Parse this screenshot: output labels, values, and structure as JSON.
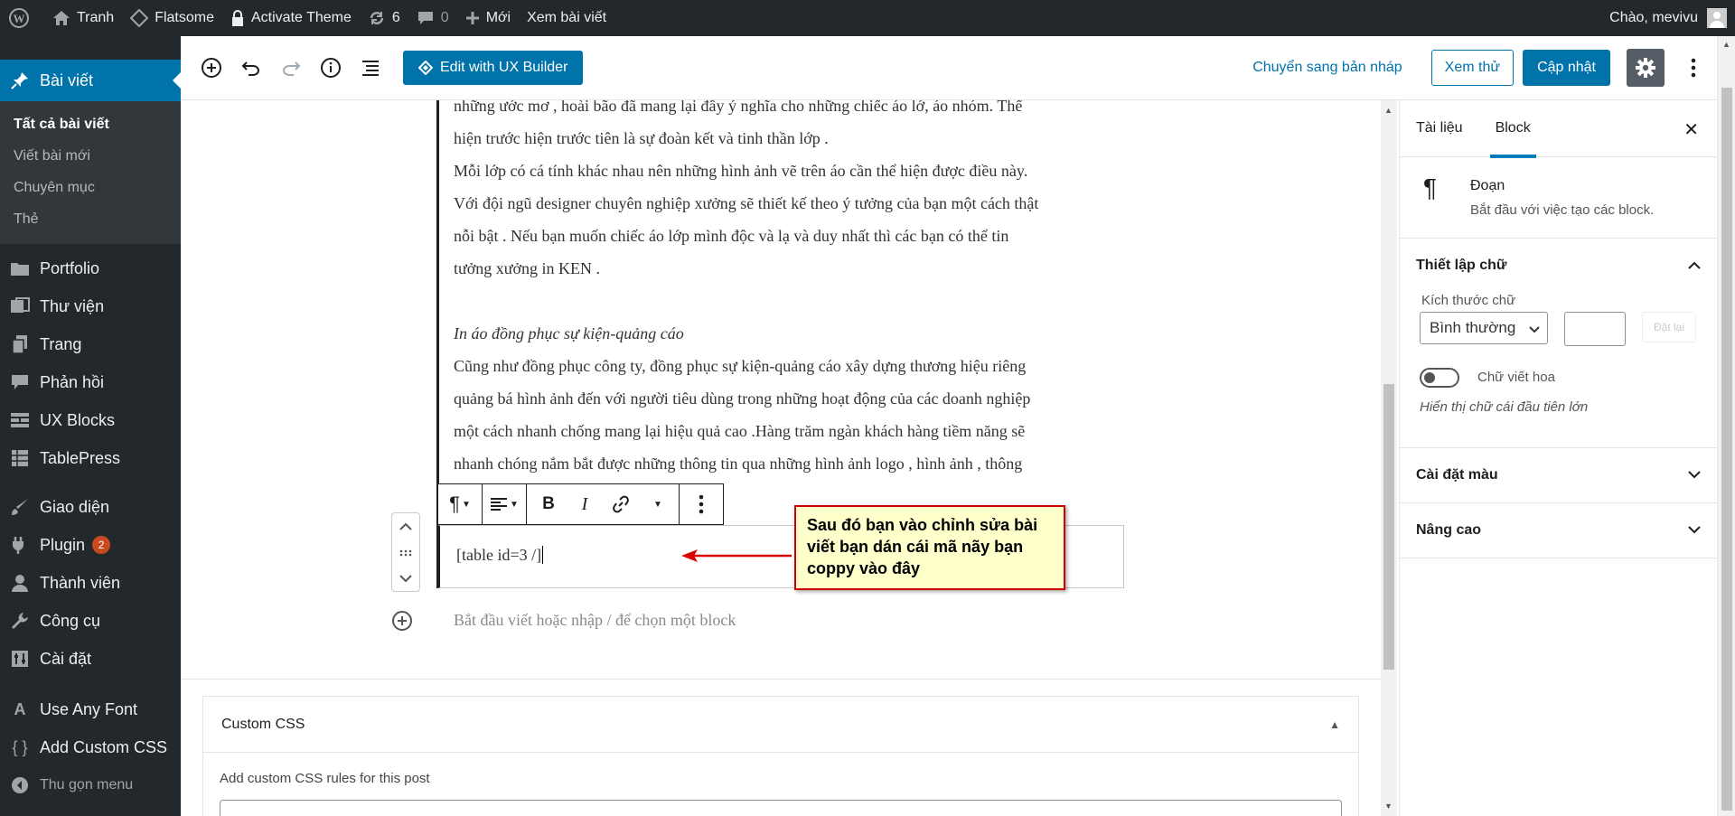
{
  "adminbar": {
    "site_name": "Tranh",
    "theme": "Flatsome",
    "activate": "Activate Theme",
    "updates_count": "6",
    "comments_count": "0",
    "new": "Mới",
    "view_post": "Xem bài viết",
    "greeting": "Chào, mevivu"
  },
  "menu": {
    "posts": "Bài viết",
    "sub": [
      "Tất cả bài viết",
      "Viết bài mới",
      "Chuyên mục",
      "Thẻ"
    ],
    "items": [
      "Portfolio",
      "Thư viện",
      "Trang",
      "Phản hồi",
      "UX Blocks",
      "TablePress",
      "Giao diện",
      "Plugin",
      "Thành viên",
      "Công cụ",
      "Cài đặt",
      "Use Any Font",
      "Add Custom CSS"
    ],
    "plugin_badge": "2",
    "collapse": "Thu gọn menu"
  },
  "header": {
    "ux_builder": "Edit with UX Builder",
    "switch_draft": "Chuyển sang bản nháp",
    "preview": "Xem thử",
    "update": "Cập nhật"
  },
  "content": {
    "lines_top": [
      "những ước mơ , hoài bão đã mang lại đầy ý nghĩa cho những chiếc áo lớ, áo nhóm. Thể",
      "hiện trước hiện trước tiên là sự đoàn kết và tinh thần lớp .",
      " Mỗi lớp có cá tính khác nhau nên những hình ảnh vẽ trên áo cần thể hiện được điều này.",
      "Với đội ngũ designer chuyên nghiệp xưởng sẽ thiết kế theo ý tưởng của bạn một cách thật",
      "nỗi bật . Nếu bạn muốn chiếc áo lớp mình độc và lạ và duy nhất thì các bạn có thể tin",
      "tưởng xưởng in KEN ."
    ],
    "heading_italic": " In áo đồng phục sự kiện-quảng cáo",
    "lines_bottom": [
      "Cũng như đồng phục công ty, đồng phục sự kiện-quảng cáo xây dựng thương hiệu riêng",
      "quảng bá hình ảnh đến với người tiêu dùng trong những hoạt động của các doanh nghiệp",
      "một cách nhanh chống mang lại hiệu quả cao .Hàng trăm ngàn khách hàng tiềm năng sẽ",
      "nhanh chóng nắm bắt được những thông tin  qua những hình ảnh logo , hình ảnh , thông"
    ],
    "shortcode": "[table id=3 /]",
    "callout": "Sau đó bạn vào chỉnh sửa bài viết bạn dán cái mã nãy bạn coppy vào đây",
    "appender_placeholder": "Bắt đầu viết hoặc nhập / để chọn một block"
  },
  "custom_css": {
    "title": "Custom CSS",
    "desc": "Add custom CSS rules for this post"
  },
  "sidebar": {
    "tab_document": "Tài liệu",
    "tab_block": "Block",
    "block_title": "Đoạn",
    "block_desc": "Bắt đầu với việc tạo các block.",
    "typography": "Thiết lập chữ",
    "font_size_label": "Kích thước chữ",
    "font_size_value": "Bình thường",
    "reset": "Đặt lại",
    "dropcap": "Chữ viết hoa",
    "dropcap_help": "Hiển thị chữ cái đầu tiên lớn",
    "color_settings": "Cài đặt màu",
    "advanced": "Nâng cao"
  }
}
